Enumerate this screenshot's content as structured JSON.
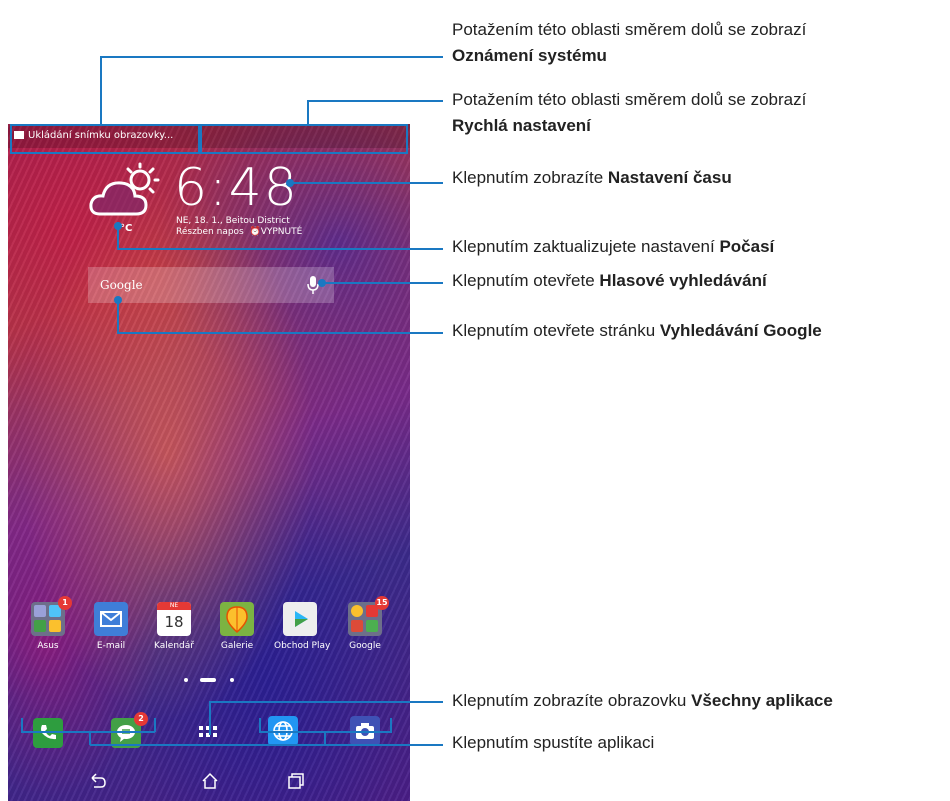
{
  "status_bar": {
    "notification_text": "Ukládání snímku obrazovky..."
  },
  "clock": {
    "time": "6:48",
    "date_location": "NE, 18. 1., Beitou District",
    "conditions": "Részben napos",
    "alarm": "VYPNUTÉ",
    "temperature": "°C"
  },
  "search": {
    "label": "Google"
  },
  "apps": [
    {
      "label": "Asus",
      "badge": "1",
      "icon": "folder-icon"
    },
    {
      "label": "E-mail",
      "badge": "",
      "icon": "mail-icon"
    },
    {
      "label": "Kalendář",
      "badge": "",
      "icon": "calendar-icon",
      "calendar_header": "NE",
      "calendar_day": "18"
    },
    {
      "label": "Galerie",
      "badge": "",
      "icon": "gallery-icon"
    },
    {
      "label": "Obchod Play",
      "badge": "",
      "icon": "play-store-icon"
    },
    {
      "label": "Google",
      "badge": "15",
      "icon": "google-folder-icon"
    }
  ],
  "dock": [
    {
      "name": "phone",
      "icon": "phone-icon",
      "badge": ""
    },
    {
      "name": "messages",
      "icon": "message-icon",
      "badge": "2"
    },
    {
      "name": "all-apps",
      "icon": "app-drawer-icon",
      "badge": ""
    },
    {
      "name": "browser",
      "icon": "globe-icon",
      "badge": ""
    },
    {
      "name": "camera",
      "icon": "camera-icon",
      "badge": ""
    }
  ],
  "callouts": {
    "notifications": {
      "line1": "Potažením této oblasti směrem dolů se zobrazí",
      "bold": "Oznámení systému"
    },
    "quick_settings": {
      "line1": "Potažením této oblasti směrem dolů se zobrazí",
      "bold": "Rychlá nastavení"
    },
    "time": {
      "prefix": "Klepnutím zobrazíte ",
      "bold": "Nastavení času"
    },
    "weather": {
      "prefix": "Klepnutím zaktualizujete nastavení ",
      "bold": "Počasí"
    },
    "voice": {
      "prefix": "Klepnutím otevřete ",
      "bold": "Hlasové vyhledávání"
    },
    "google": {
      "prefix": "Klepnutím otevřete stránku ",
      "bold": "Vyhledávání Google"
    },
    "all_apps": {
      "prefix": "Klepnutím zobrazíte obrazovku ",
      "bold": "Všechny aplikace"
    },
    "launch": {
      "prefix": "Klepnutím spustíte aplikaci"
    }
  },
  "colors": {
    "callout_line": "#1a78c2",
    "badge": "#e53935"
  }
}
